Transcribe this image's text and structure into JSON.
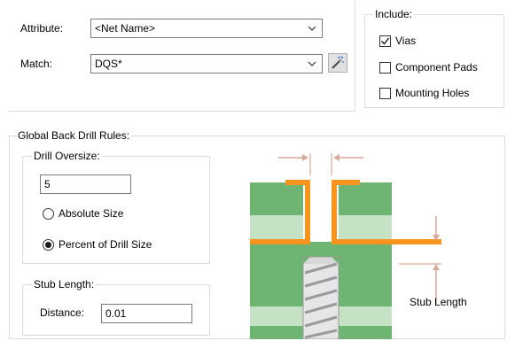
{
  "filter": {
    "attribute_label": "Attribute:",
    "attribute_value": "<Net Name>",
    "match_label": "Match:",
    "match_value": "DQS*"
  },
  "include": {
    "title": "Include:",
    "vias_label": "Vias",
    "vias_checked": true,
    "component_pads_label": "Component Pads",
    "component_pads_checked": false,
    "mounting_holes_label": "Mounting Holes",
    "mounting_holes_checked": false
  },
  "rules": {
    "title": "Global Back Drill Rules:",
    "oversize": {
      "title": "Drill Oversize:",
      "value": "5",
      "absolute_label": "Absolute Size",
      "percent_label": "Percent of Drill Size",
      "selected": "percent"
    },
    "stub": {
      "title": "Stub Length:",
      "distance_label": "Distance:",
      "distance_value": "0.01"
    },
    "diagram": {
      "stub_length_label": "Stub Length"
    }
  },
  "colors": {
    "board_green": "#6eb472",
    "light_green": "#c6e2c4",
    "copper_orange": "#f7941d",
    "arrow_tan": "#d9a99a"
  },
  "icons": {
    "wand": "magic-wand-icon",
    "dropdown": "chevron-down-icon"
  }
}
